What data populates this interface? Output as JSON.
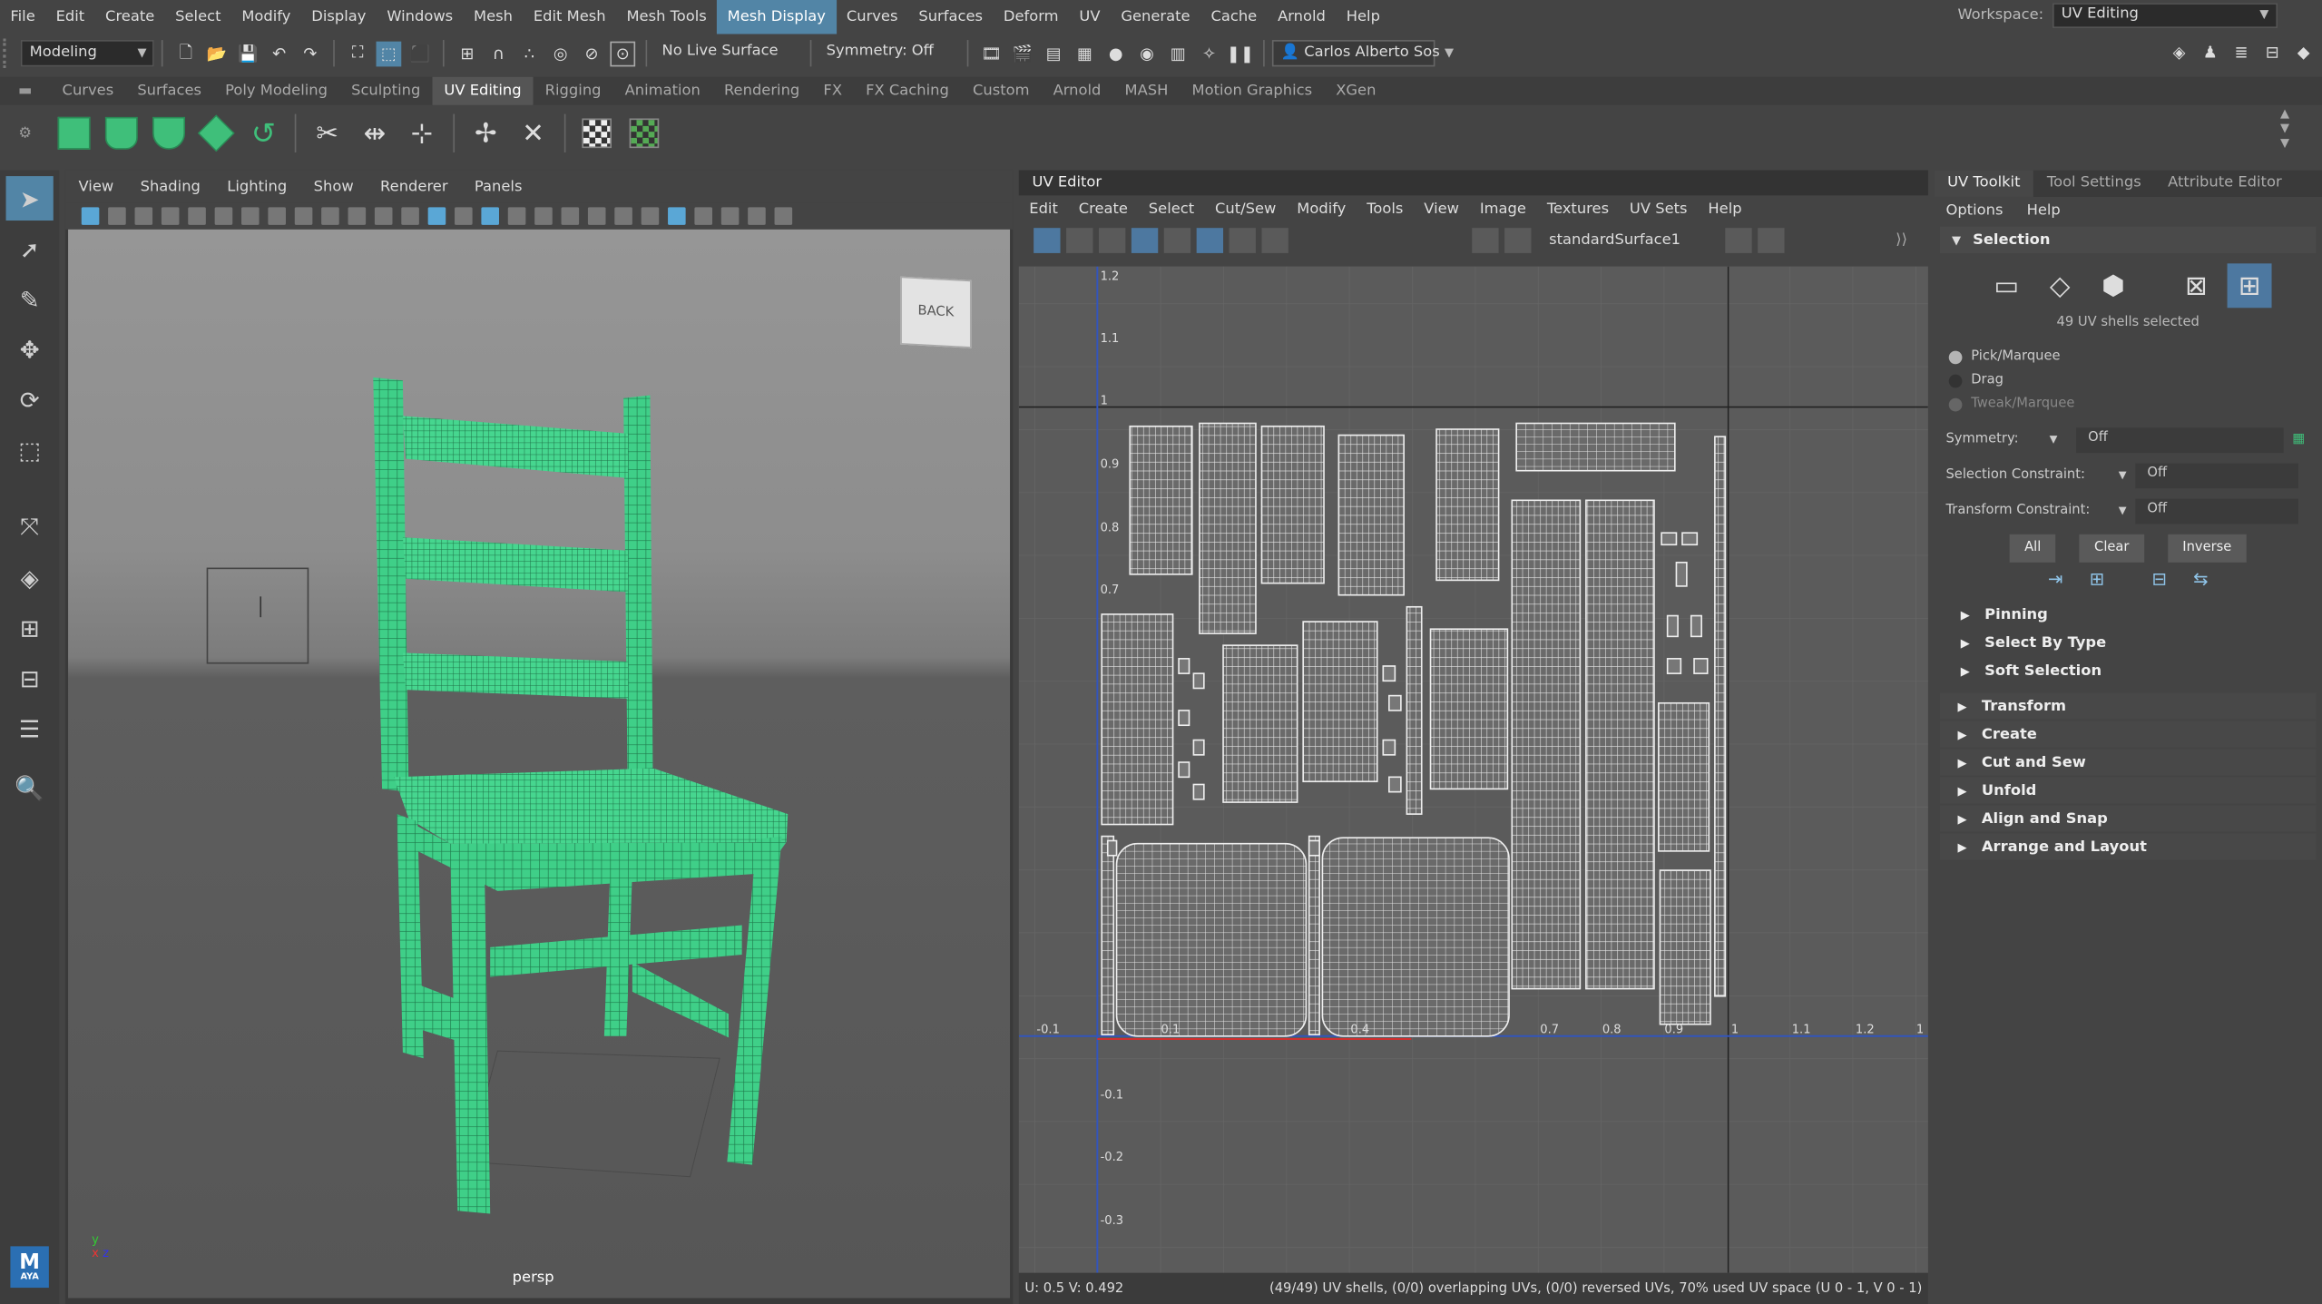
{
  "menubar": {
    "items": [
      "File",
      "Edit",
      "Create",
      "Select",
      "Modify",
      "Display",
      "Windows",
      "Mesh",
      "Edit Mesh",
      "Mesh Tools",
      "Mesh Display",
      "Curves",
      "Surfaces",
      "Deform",
      "UV",
      "Generate",
      "Cache",
      "Arnold",
      "Help"
    ],
    "active": "Mesh Display",
    "workspace_label": "Workspace:",
    "workspace_value": "UV Editing"
  },
  "statusline": {
    "mode": "Modeling",
    "live_surface": "No Live Surface",
    "symmetry": "Symmetry: Off",
    "user": "Carlos Alberto Sos"
  },
  "shelf_tabs": [
    "Curves",
    "Surfaces",
    "Poly Modeling",
    "Sculpting",
    "UV Editing",
    "Rigging",
    "Animation",
    "Rendering",
    "FX",
    "FX Caching",
    "Custom",
    "Arnold",
    "MASH",
    "Motion Graphics",
    "XGen"
  ],
  "shelf_active": "UV Editing",
  "viewport": {
    "menu": [
      "View",
      "Shading",
      "Lighting",
      "Show",
      "Renderer",
      "Panels"
    ],
    "cube_label": "BACK",
    "camera": "persp"
  },
  "uv_editor": {
    "title": "UV Editor",
    "menu": [
      "Edit",
      "Create",
      "Select",
      "Cut/Sew",
      "Modify",
      "Tools",
      "View",
      "Image",
      "Textures",
      "UV Sets",
      "Help"
    ],
    "texture": "standardSurface1",
    "x_labels": [
      "-0.1",
      "0.1",
      "0.4",
      "0.7",
      "0.8",
      "0.9",
      "1",
      "1.1",
      "1.2",
      "1"
    ],
    "y_labels": [
      "1.2",
      "1.1",
      "1",
      "0.9",
      "0.8",
      "0.7",
      "-0.1",
      "-0.2",
      "-0.3"
    ],
    "coords": "U: 0.5 V: 0.492",
    "status": "(49/49) UV shells, (0/0) overlapping UVs, (0/0) reversed UVs, 70% used UV space (U 0 - 1, V 0 - 1)"
  },
  "side": {
    "tabs": [
      "UV Toolkit",
      "Tool Settings",
      "Attribute Editor"
    ],
    "options": [
      "Options",
      "Help"
    ],
    "selection_header": "Selection",
    "shells_info": "49 UV shells selected",
    "radios": [
      "Pick/Marquee",
      "Drag",
      "Tweak/Marquee"
    ],
    "symmetry_label": "Symmetry:",
    "symmetry_value": "Off",
    "sel_constraint_label": "Selection Constraint:",
    "sel_constraint_value": "Off",
    "trans_constraint_label": "Transform Constraint:",
    "trans_constraint_value": "Off",
    "buttons": [
      "All",
      "Clear",
      "Inverse"
    ],
    "sub_sections": [
      "Pinning",
      "Select By Type",
      "Soft Selection"
    ],
    "sections": [
      "Transform",
      "Create",
      "Cut and Sew",
      "Unfold",
      "Align and Snap",
      "Arrange and Layout"
    ]
  },
  "logo": {
    "letter": "M",
    "sub": "AYA"
  }
}
